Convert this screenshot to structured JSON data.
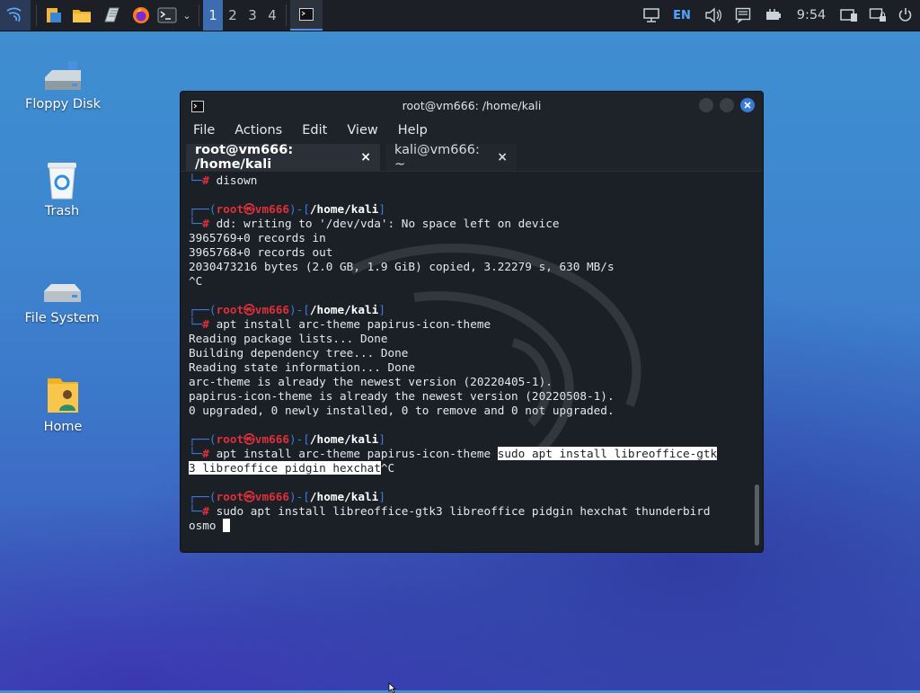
{
  "panel": {
    "workspaces": [
      "1",
      "2",
      "3",
      "4"
    ],
    "active_workspace": "1",
    "language": "EN",
    "clock": "9:54"
  },
  "desktop_icons": [
    {
      "label": "Floppy Disk",
      "icon": "floppy-disk-icon"
    },
    {
      "label": "Trash",
      "icon": "trash-icon"
    },
    {
      "label": "File System",
      "icon": "drive-icon"
    },
    {
      "label": "Home",
      "icon": "home-folder-icon"
    }
  ],
  "window": {
    "title": "root@vm666: /home/kali",
    "menu": [
      "File",
      "Actions",
      "Edit",
      "View",
      "Help"
    ],
    "tabs": [
      {
        "label": "root@vm666: /home/kali",
        "close": "×"
      },
      {
        "label": "kali@vm666: ~",
        "close": "×"
      }
    ]
  },
  "terminal": {
    "prompt_user": "root㉿vm666",
    "prompt_path": "/home/kali",
    "lines": {
      "l1": "disown",
      "l4": "dd: writing to '/dev/vda': No space left on device",
      "l5": "3965769+0 records in",
      "l6": "3965768+0 records out",
      "l7": "2030473216 bytes (2.0 GB, 1.9 GiB) copied, 3.22279 s, 630 MB/s",
      "l8": "^C",
      "l11": "apt install arc-theme papirus-icon-theme",
      "l12": "Reading package lists... Done",
      "l13": "Building dependency tree... Done",
      "l14": "Reading state information... Done",
      "l15": "arc-theme is already the newest version (20220405-1).",
      "l16": "papirus-icon-theme is already the newest version (20220508-1).",
      "l17": "0 upgraded, 0 newly installed, 0 to remove and 0 not upgraded.",
      "l20a": "apt install arc-theme papirus-icon-theme ",
      "l20b": "sudo apt install libreoffice-gtk",
      "l21a": "3 libreoffice pidgin hexchat",
      "l21b": "^C",
      "l24": "sudo apt install libreoffice-gtk3 libreoffice pidgin hexchat thunderbird",
      "l25": "osmo "
    }
  },
  "colors": {
    "panel_bg": "#1c2026",
    "active_workspace": "#3d6db0",
    "terminal_bg": "#1b1f26",
    "prompt_frame": "#3b7be0",
    "prompt_user": "#e0303a",
    "close_button": "#3a7bd5"
  }
}
